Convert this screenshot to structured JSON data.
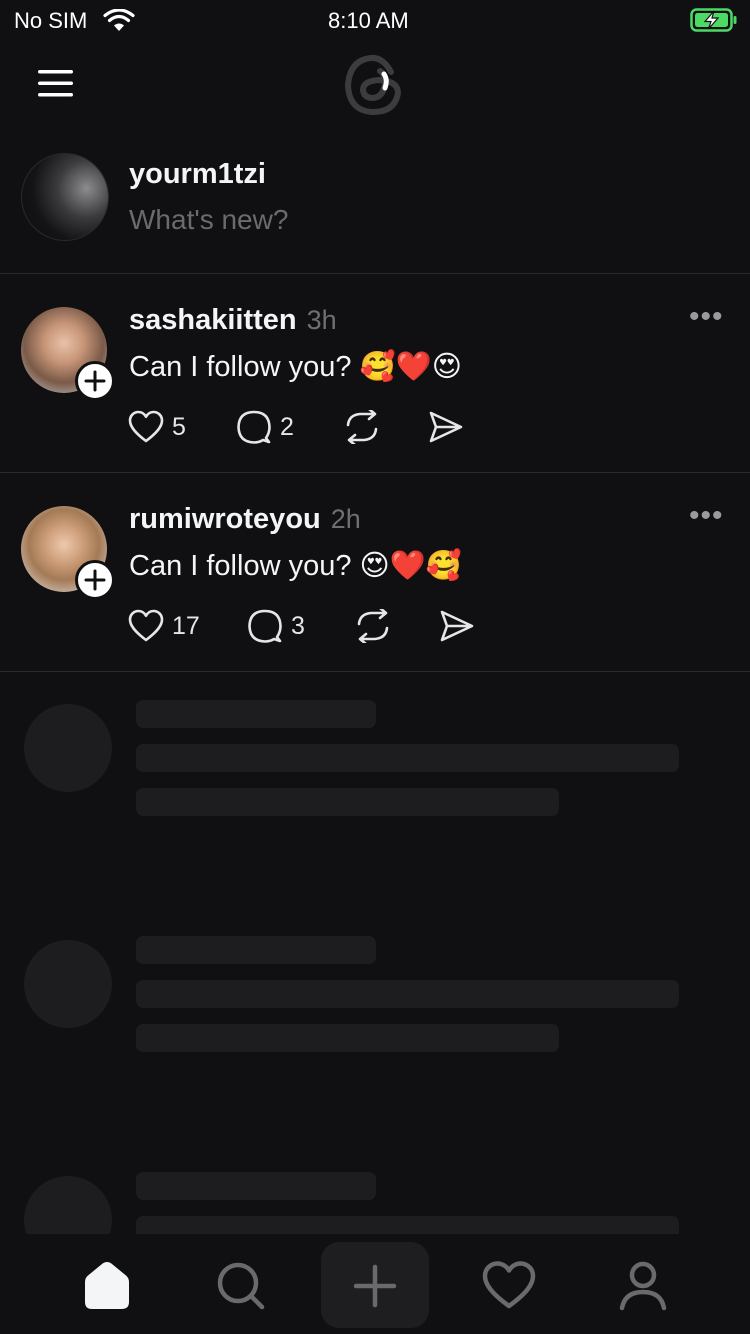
{
  "status_bar": {
    "carrier": "No SIM",
    "time": "8:10 AM"
  },
  "composer": {
    "username": "yourm1tzi",
    "placeholder": "What's new?"
  },
  "posts": [
    {
      "username": "sashakiitten",
      "time": "3h",
      "text": "Can I follow you? 🥰❤️😍",
      "likes": "5",
      "replies": "2"
    },
    {
      "username": "rumiwroteyou",
      "time": "2h",
      "text": "Can I follow you? 😍❤️🥰",
      "likes": "17",
      "replies": "3"
    }
  ],
  "icons": {
    "menu": "menu-icon",
    "logo": "threads-logo-icon",
    "like": "heart-icon",
    "reply": "comment-icon",
    "repost": "repost-icon",
    "share": "send-icon",
    "more": "more-icon",
    "tabs": [
      "home-icon",
      "search-icon",
      "compose-icon",
      "activity-icon",
      "profile-icon"
    ]
  },
  "colors": {
    "background": "#101012",
    "text": "#f3f5f7",
    "muted": "#6f6f72",
    "skeleton": "#1d1d1f",
    "battery": "#4cd964"
  }
}
